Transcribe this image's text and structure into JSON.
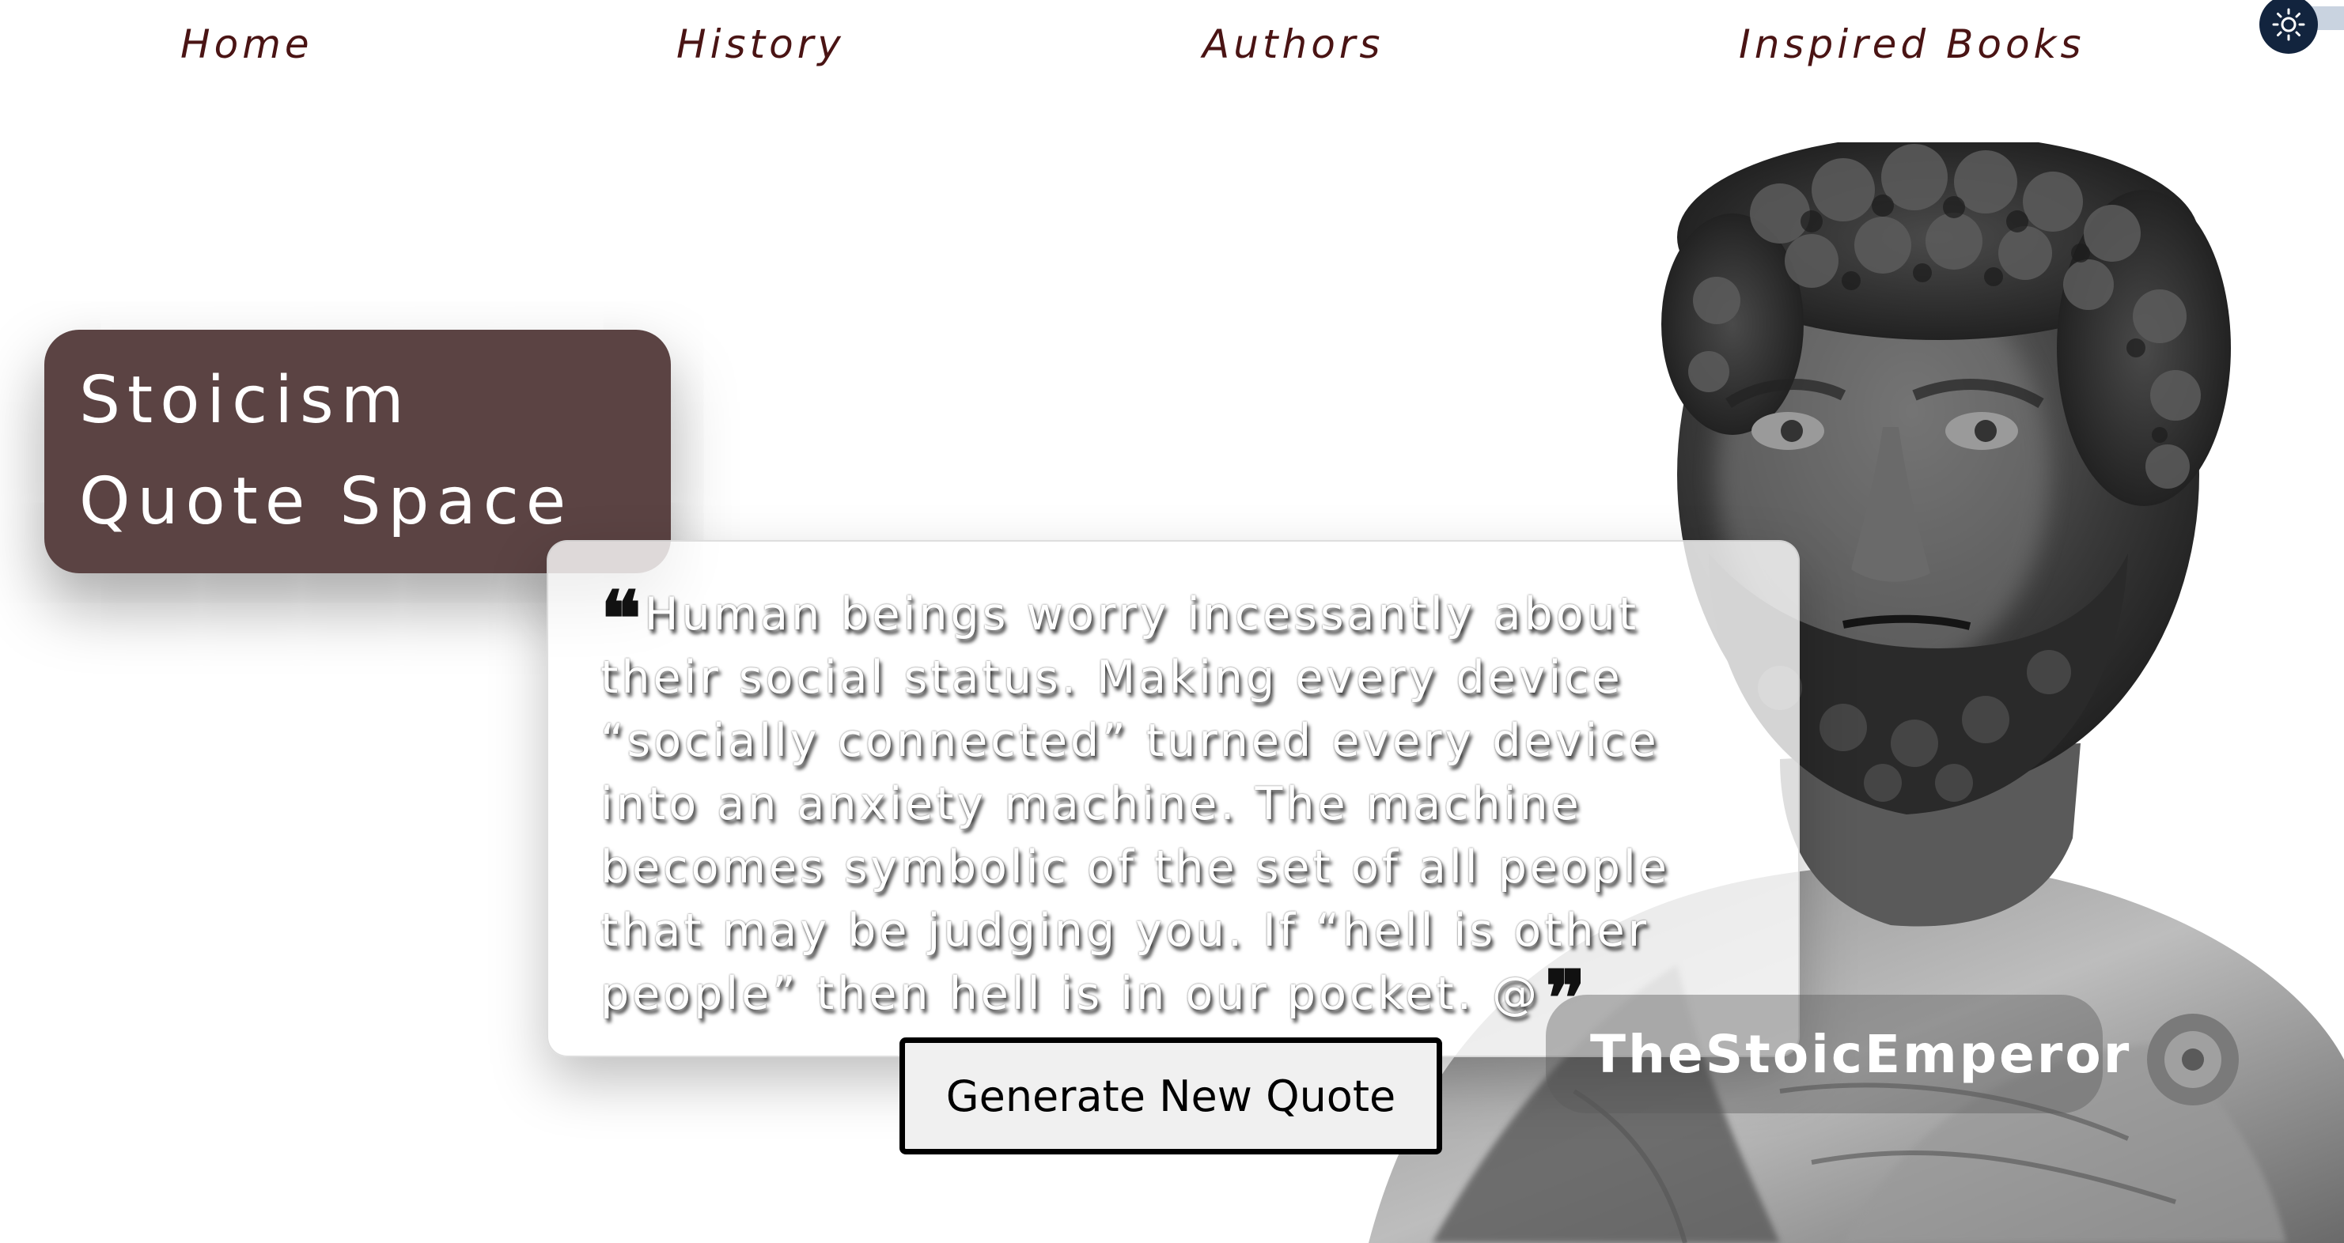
{
  "nav": {
    "items": [
      {
        "label": "Home"
      },
      {
        "label": "History"
      },
      {
        "label": "Authors"
      },
      {
        "label": "Inspired Books"
      }
    ]
  },
  "theme_toggle": {
    "icon": "sun-icon",
    "background": "#12243e"
  },
  "hero": {
    "title_line1": "Stoicism",
    "title_line2": "Quote Space",
    "card_color": "#5b4343"
  },
  "quote": {
    "text": "Human beings worry incessantly about their social status. Making every device “socially connected” turned every device into an anxiety machine. The machine becomes symbolic of the set of all people that may be judging you. If “hell is other people” then hell is in our pocket. @",
    "open_mark": "❝",
    "close_mark": "❞",
    "author": "TheStoicEmperor"
  },
  "actions": {
    "generate_label": "Generate New Quote"
  },
  "colors": {
    "nav_text": "#4a1414",
    "button_border": "#000000",
    "button_bg": "#f0f0f0"
  }
}
